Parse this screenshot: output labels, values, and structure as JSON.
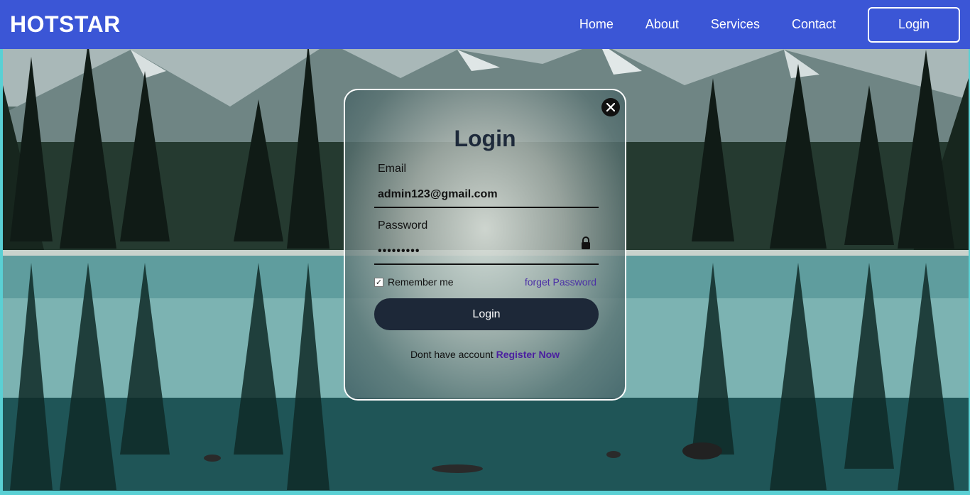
{
  "navbar": {
    "brand": "HOTSTAR",
    "links": [
      "Home",
      "About",
      "Services",
      "Contact"
    ],
    "login_button": "Login"
  },
  "login_form": {
    "title": "Login",
    "email_label": "Email",
    "email_value": "admin123@gmail.com",
    "password_label": "Password",
    "password_value": "•••••••••",
    "remember_label": "Remember me",
    "remember_checked": true,
    "forget_link": "forget Password",
    "submit_label": "Login",
    "register_prompt": "Dont have account",
    "register_link": "Register Now"
  },
  "icons": {
    "close": "close-icon",
    "lock": "lock-icon",
    "checkbox": "check-icon"
  },
  "colors": {
    "navbar": "#3b56d6",
    "login_button": "#1d2838",
    "link": "#4b2fa6"
  }
}
